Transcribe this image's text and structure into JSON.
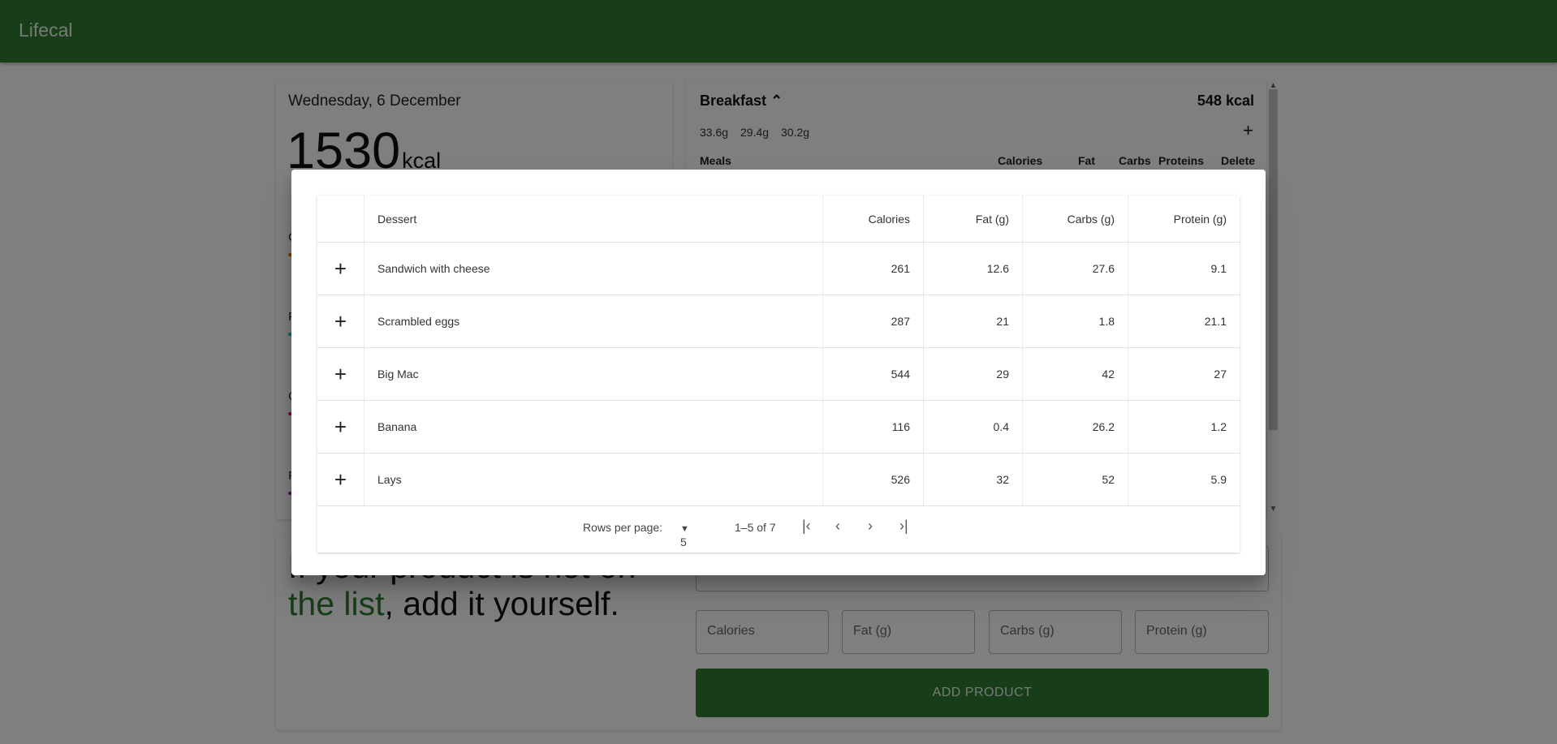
{
  "app": {
    "title": "Lifecal"
  },
  "summary": {
    "date": "Wednesday, 6 December",
    "kcal_value": "1530",
    "kcal_unit": "kcal",
    "nutrients": [
      {
        "label_fragment": "C",
        "color": "#f57c00"
      },
      {
        "label_fragment": "F",
        "color": "#26c6da"
      },
      {
        "label_fragment": "C",
        "color": "#e91e63"
      },
      {
        "label_fragment": "F",
        "color": "#9c27b0"
      }
    ]
  },
  "meal": {
    "title": "Breakfast",
    "total": "548 kcal",
    "macros": [
      "33.6g",
      "29.4g",
      "30.2g"
    ],
    "columns": [
      "Meals",
      "Calories",
      "Fat",
      "Carbs",
      "Proteins",
      "Delete"
    ]
  },
  "promo": {
    "line_partial": "If your product is not on",
    "highlight": "the list",
    "rest": ", add it yourself."
  },
  "form": {
    "fields": [
      "Calories",
      "Fat (g)",
      "Carbs (g)",
      "Protein (g)"
    ],
    "submit_label": "ADD PRODUCT"
  },
  "dialog": {
    "columns": [
      "Dessert",
      "Calories",
      "Fat (g)",
      "Carbs (g)",
      "Protein (g)"
    ],
    "rows": [
      {
        "name": "Sandwich with cheese",
        "calories": "261",
        "fat": "12.6",
        "carbs": "27.6",
        "protein": "9.1"
      },
      {
        "name": "Scrambled eggs",
        "calories": "287",
        "fat": "21",
        "carbs": "1.8",
        "protein": "21.1"
      },
      {
        "name": "Big Mac",
        "calories": "544",
        "fat": "29",
        "carbs": "42",
        "protein": "27"
      },
      {
        "name": "Banana",
        "calories": "116",
        "fat": "0.4",
        "carbs": "26.2",
        "protein": "1.2"
      },
      {
        "name": "Lays",
        "calories": "526",
        "fat": "32",
        "carbs": "52",
        "protein": "5.9"
      }
    ],
    "pagination": {
      "rows_per_page_label": "Rows per page:",
      "rows_per_page_value": "5",
      "range": "1–5 of 7"
    }
  },
  "colors": {
    "primary": "#2e7d32",
    "primary_text": "#e8f5e9"
  }
}
